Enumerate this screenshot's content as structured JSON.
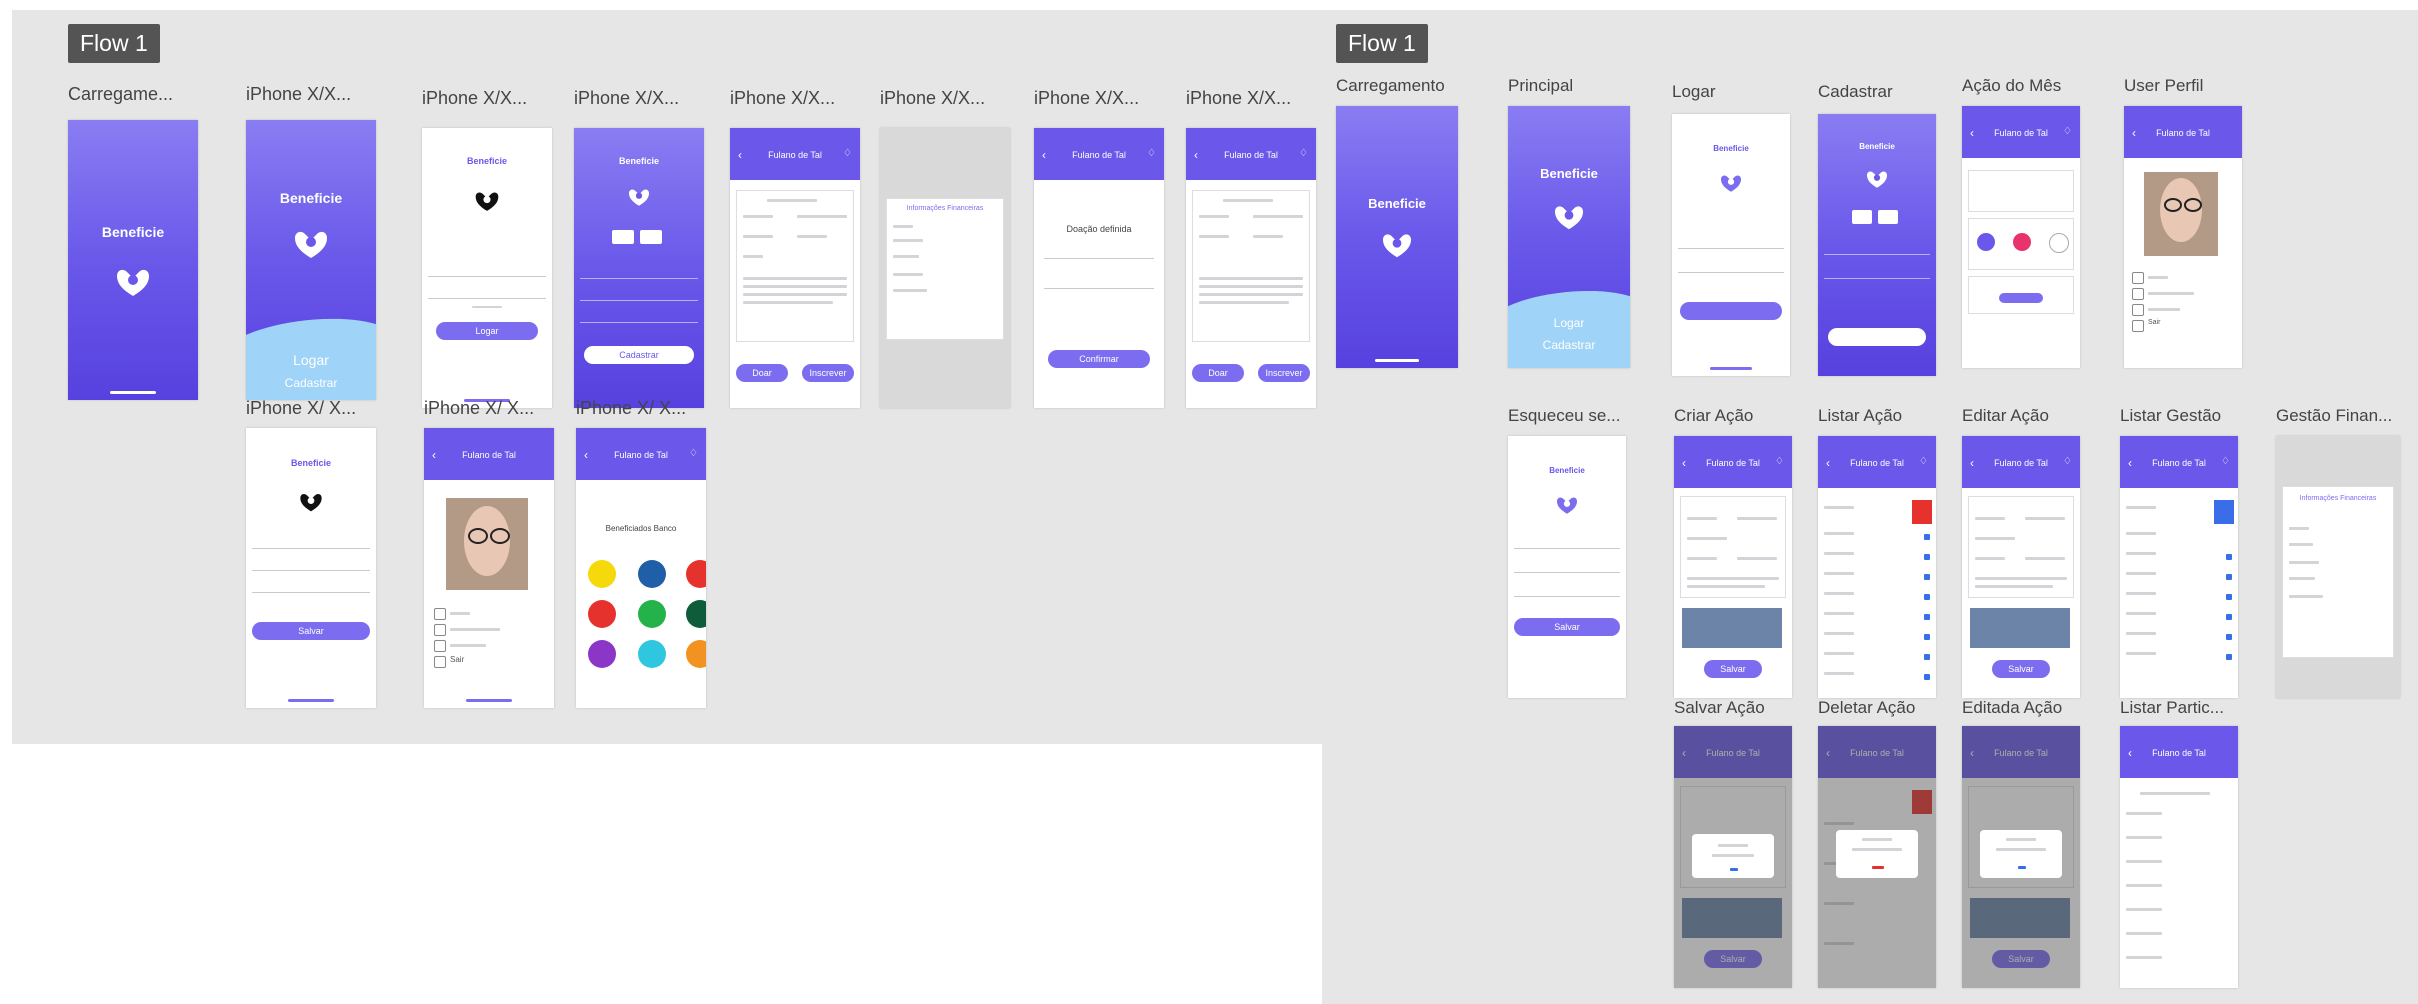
{
  "left_canvas": {
    "flow_label": "Flow 1",
    "artboards": [
      {
        "label": "Carregame...",
        "title": "Beneficie"
      },
      {
        "label": "iPhone X/X...",
        "title": "Beneficie",
        "btn1": "Logar",
        "btn2": "Cadastrar"
      },
      {
        "label": "iPhone X/X...",
        "title": "Beneficie",
        "btn": "Logar"
      },
      {
        "label": "iPhone X/X...",
        "title": "Beneficie",
        "btn": "Cadastrar"
      },
      {
        "label": "iPhone X/X...",
        "header": "Fulano de Tal",
        "btn1": "Doar",
        "btn2": "Inscrever"
      },
      {
        "label": "iPhone X/X...",
        "title": "Informações Financeiras"
      },
      {
        "label": "iPhone X/X...",
        "header": "Fulano de Tal",
        "heading": "Doação definida",
        "btn": "Confirmar"
      },
      {
        "label": "iPhone X/X...",
        "header": "Fulano de Tal",
        "btn1": "Doar",
        "btn2": "Inscrever"
      },
      {
        "label": "iPhone X/ X...",
        "title": "Beneficie",
        "btn": "Salvar"
      },
      {
        "label": "iPhone X/ X...",
        "header": "Fulano de Tal",
        "menu": [
          "Sair"
        ]
      },
      {
        "label": "iPhone X/ X...",
        "header": "Fulano de Tal",
        "heading": "Beneficiados Banco"
      }
    ]
  },
  "right_canvas": {
    "flow_label": "Flow 1",
    "artboards": [
      {
        "label": "Carregamento",
        "title": "Beneficie"
      },
      {
        "label": "Principal",
        "title": "Beneficie",
        "btn1": "Logar",
        "btn2": "Cadastrar"
      },
      {
        "label": "Logar",
        "title": "Beneficie"
      },
      {
        "label": "Cadastrar",
        "title": "Beneficie"
      },
      {
        "label": "Ação do Mês",
        "header": "Fulano de Tal"
      },
      {
        "label": "User Perfil",
        "header": "Fulano de Tal",
        "menu": [
          "Sair"
        ]
      },
      {
        "label": "Esqueceu se...",
        "title": "Beneficie",
        "btn": "Salvar"
      },
      {
        "label": "Criar Ação",
        "header": "Fulano de Tal",
        "btn": "Salvar"
      },
      {
        "label": "Listar Ação",
        "header": "Fulano de Tal"
      },
      {
        "label": "Editar Ação",
        "header": "Fulano de Tal",
        "btn": "Salvar"
      },
      {
        "label": "Listar Gestão",
        "header": "Fulano de Tal"
      },
      {
        "label": "Gestão Finan...",
        "title": "Informações Financeiras"
      },
      {
        "label": "Salvar Ação",
        "header": "Fulano de Tal",
        "btn": "Salvar"
      },
      {
        "label": "Deletar Ação",
        "header": "Fulano de Tal"
      },
      {
        "label": "Editada Ação",
        "header": "Fulano de Tal",
        "btn": "Salvar"
      },
      {
        "label": "Listar Partic...",
        "header": "Fulano de Tal"
      }
    ]
  },
  "colors": {
    "primary": "#6a58ea",
    "wave": "#9fd3f7",
    "canvas": "#e6e6e6",
    "flow_tag": "#545454"
  },
  "icons": [
    "hands-heart-icon",
    "back-arrow-icon",
    "bell-icon",
    "profile-photo"
  ]
}
